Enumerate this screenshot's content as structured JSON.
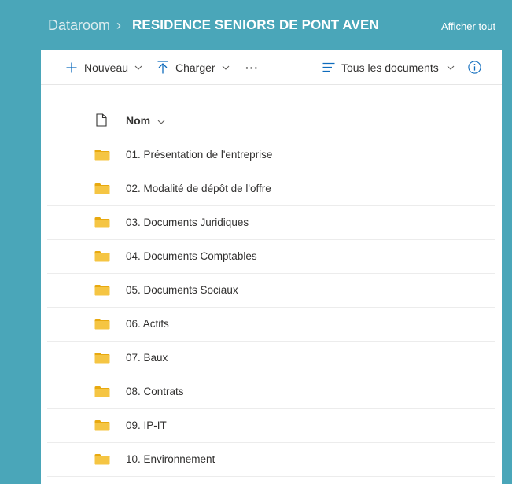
{
  "breadcrumb": {
    "root": "Dataroom",
    "separator": "›",
    "current": "RESIDENCE SENIORS DE PONT AVEN"
  },
  "header": {
    "show_all_label": "Afficher tout"
  },
  "toolbar": {
    "new_label": "Nouveau",
    "upload_label": "Charger",
    "more_label": "···",
    "view_label": "Tous les documents",
    "icons": {
      "new": "plus-icon",
      "upload": "upload-icon",
      "view": "view-lines-icon",
      "info": "info-icon"
    }
  },
  "list": {
    "name_column": "Nom",
    "items": [
      {
        "label": "01. Présentation de l'entreprise"
      },
      {
        "label": "02. Modalité de dépôt de l'offre"
      },
      {
        "label": "03. Documents Juridiques"
      },
      {
        "label": "04. Documents Comptables"
      },
      {
        "label": "05. Documents Sociaux"
      },
      {
        "label": "06. Actifs"
      },
      {
        "label": "07. Baux"
      },
      {
        "label": "08. Contrats"
      },
      {
        "label": "09. IP-IT"
      },
      {
        "label": "10. Environnement"
      }
    ]
  },
  "colors": {
    "background": "#4aa6b9",
    "accent": "#0f6cbd",
    "folder": "#f5c543"
  }
}
